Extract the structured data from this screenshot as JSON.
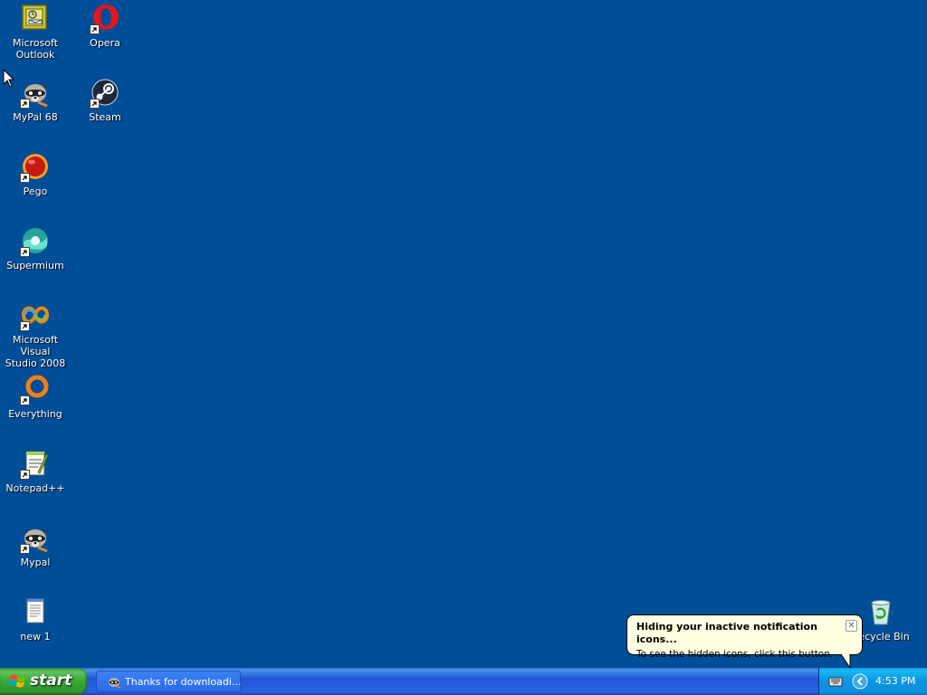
{
  "desktop": {
    "background_color": "#004e98",
    "icons": [
      {
        "id": "outlook",
        "label": "Microsoft\nOutlook",
        "icon": "outlook-icon",
        "shortcut": false
      },
      {
        "id": "opera",
        "label": "Opera",
        "icon": "opera-icon",
        "shortcut": true
      },
      {
        "id": "mypal68",
        "label": "MyPal 68",
        "icon": "mypal-raccoon-icon",
        "shortcut": true
      },
      {
        "id": "steam",
        "label": "Steam",
        "icon": "steam-icon",
        "shortcut": true
      },
      {
        "id": "pego",
        "label": "Pego",
        "icon": "pego-icon",
        "shortcut": true
      },
      {
        "id": "supermium",
        "label": "Supermium",
        "icon": "supermium-icon",
        "shortcut": true
      },
      {
        "id": "vs2008",
        "label": "Microsoft Visual\nStudio 2008",
        "icon": "visual-studio-icon",
        "shortcut": true
      },
      {
        "id": "everything",
        "label": "Everything",
        "icon": "everything-icon",
        "shortcut": true
      },
      {
        "id": "notepadpp",
        "label": "Notepad++",
        "icon": "notepadpp-icon",
        "shortcut": true
      },
      {
        "id": "mypal",
        "label": "Mypal",
        "icon": "mypal-raccoon-icon",
        "shortcut": true
      },
      {
        "id": "new1",
        "label": "new 1",
        "icon": "text-file-icon",
        "shortcut": false
      },
      {
        "id": "recycle",
        "label": "Recycle Bin",
        "icon": "recycle-bin-icon",
        "shortcut": false
      }
    ]
  },
  "balloon": {
    "title": "Hiding your inactive notification icons...",
    "text": "To see the hidden icons, click this button.",
    "close_icon": "close-icon",
    "background_color": "#ffffe1"
  },
  "taskbar": {
    "start_label": "start",
    "task_window_label": "Thanks for downloadi...",
    "tray": {
      "clock": "4:53 PM",
      "icons": [
        "keyboard-icon",
        "show-hidden-icons-chevron-icon"
      ]
    },
    "start_color": "#37a837",
    "taskbar_color": "#2157d7",
    "tray_color": "#0c96e4"
  }
}
